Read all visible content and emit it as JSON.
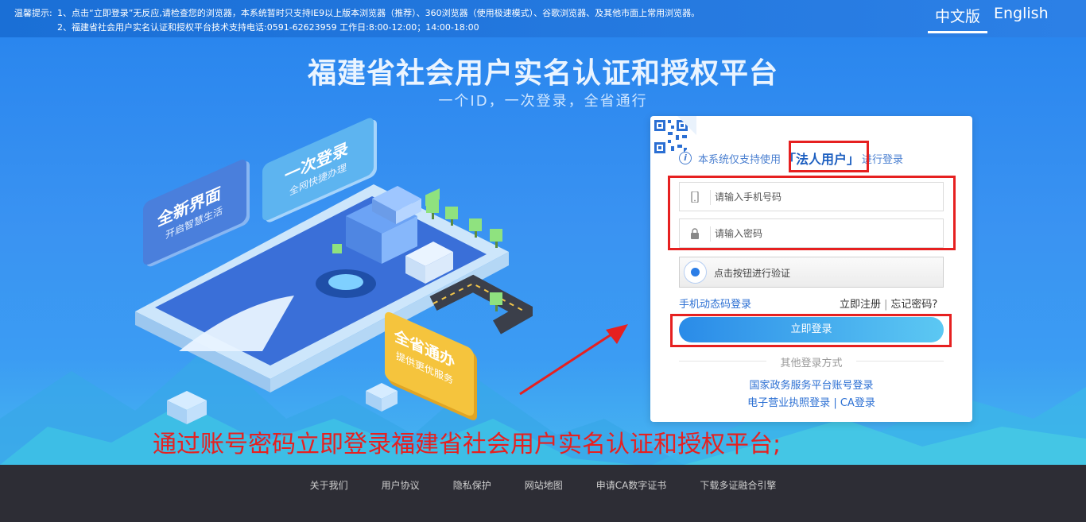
{
  "notice": {
    "label": "温馨提示:",
    "line1": "1、点击“立即登录”无反应,请检查您的浏览器，本系统暂时只支持IE9以上版本浏览器（推荐）、360浏览器（使用极速模式）、谷歌浏览器、及其他市面上常用浏览器。",
    "line2": "2、福建省社会用户实名认证和授权平台技术支持电话:0591-62623959 工作日:8:00-12:00；14:00-18:00"
  },
  "language": {
    "zh": "中文版",
    "en": "English",
    "active": "zh"
  },
  "hero": {
    "title": "福建省社会用户实名认证和授权平台",
    "subtitle": "一个ID，一次登录，全省通行",
    "badges": {
      "new_ui": "全新界面",
      "new_ui_sub": "开启智慧生活",
      "one_login": "一次登录",
      "one_login_sub": "全网快捷办理",
      "province": "全省通办",
      "province_sub": "提供更优服务"
    }
  },
  "login": {
    "tip_prefix": "本系统仅支持使用",
    "tip_highlight": "「法人用户」",
    "tip_suffix": "进行登录",
    "phone_placeholder": "请输入手机号码",
    "password_placeholder": "请输入密码",
    "verify_label": "点击按钮进行验证",
    "sms_login": "手机动态码登录",
    "register": "立即注册",
    "forgot": "忘记密码?",
    "separator": "|",
    "submit": "立即登录",
    "other_methods": "其他登录方式",
    "gov_account": "国家政务服务平台账号登录",
    "license_login": "电子营业执照登录",
    "ca_login": "CA登录"
  },
  "annotation": "通过账号密码立即登录福建省社会用户实名认证和授权平台;",
  "footer": {
    "links": [
      "关于我们",
      "用户协议",
      "隐私保护",
      "网站地图",
      "申请CA数字证书",
      "下载多证融合引擎"
    ]
  },
  "colors": {
    "brand_blue": "#2c80e6",
    "annotation_red": "#e62020",
    "footer_bg": "#2d2d35"
  }
}
